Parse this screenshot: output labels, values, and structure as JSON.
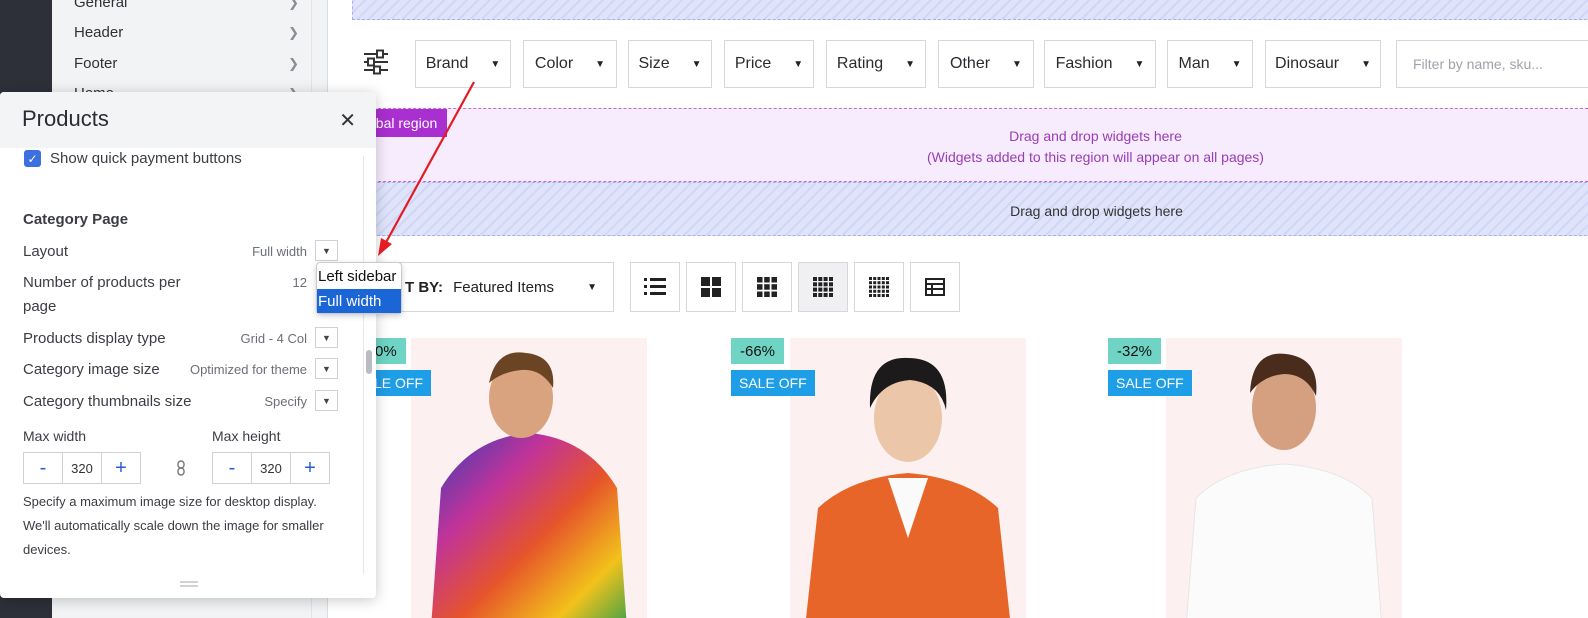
{
  "sidebar": {
    "items": [
      {
        "label": "General"
      },
      {
        "label": "Header"
      },
      {
        "label": "Footer"
      },
      {
        "label": "Home"
      }
    ]
  },
  "filters": {
    "buttons": [
      "Brand",
      "Color",
      "Size",
      "Price",
      "Rating",
      "Other",
      "Fashion",
      "Man",
      "Dinosaur"
    ],
    "search_placeholder": "Filter by name, sku..."
  },
  "regions": {
    "global_tag": "obal region",
    "global_line1": "Drag and drop widgets here",
    "global_line2": "(Widgets added to this region will appear on all pages)",
    "drop_text": "Drag and drop widgets here"
  },
  "sort": {
    "label": "T BY:",
    "value": "Featured Items"
  },
  "products": [
    {
      "discount": "0%",
      "sale": "LE OFF",
      "image_icon": "hoodie-model-image"
    },
    {
      "discount": "-66%",
      "sale": "SALE OFF",
      "image_icon": "jacket-model-image"
    },
    {
      "discount": "-32%",
      "sale": "SALE OFF",
      "image_icon": "tshirt-model-image"
    }
  ],
  "panel": {
    "title": "Products",
    "checkbox_label": "Show quick payment buttons",
    "section_title": "Category Page",
    "rows": {
      "layout_label": "Layout",
      "layout_value": "Full width",
      "per_page_label_1": "Number of products per",
      "per_page_label_2": "page",
      "per_page_value": "12",
      "display_type_label": "Products display type",
      "display_type_value": "Grid - 4 Col",
      "image_size_label": "Category image size",
      "image_size_value": "Optimized for theme",
      "thumb_size_label": "Category thumbnails size",
      "thumb_size_value": "Specify"
    },
    "max_width_label": "Max width",
    "max_height_label": "Max height",
    "max_width_value": "320",
    "max_height_value": "320",
    "minus": "-",
    "plus": "+",
    "help_text": "Specify a maximum image size for desktop display. We'll automatically scale down the image for smaller devices."
  },
  "layout_dropdown": {
    "options": [
      "Left sidebar",
      "Full width"
    ],
    "selected": "Full width"
  },
  "colors": {
    "accent_blue": "#1a66d6",
    "global_region": "#a92fd0",
    "sale_badge": "#1f9ee8",
    "discount_badge": "#6fd4c4",
    "annotation_arrow": "#e31b23"
  }
}
